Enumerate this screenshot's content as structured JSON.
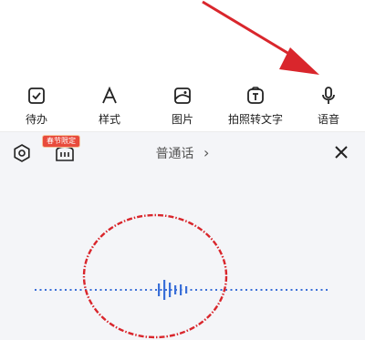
{
  "toolbar": {
    "items": [
      {
        "label": "待办",
        "icon": "checkbox-icon"
      },
      {
        "label": "样式",
        "icon": "text-style-icon"
      },
      {
        "label": "图片",
        "icon": "image-icon"
      },
      {
        "label": "拍照转文字",
        "icon": "photo-to-text-icon"
      },
      {
        "label": "语音",
        "icon": "microphone-icon"
      }
    ]
  },
  "voice_panel": {
    "language_label": "普通话",
    "language_chevron": "›",
    "promo_badge": "春节限定",
    "settings_icon": "settings-icon",
    "skin_icon": "skin-icon",
    "close_icon": "close-icon"
  },
  "colors": {
    "annotation_red": "#d9262c",
    "waveform_blue": "#3a6fd8",
    "badge_red": "#e84b3c"
  }
}
